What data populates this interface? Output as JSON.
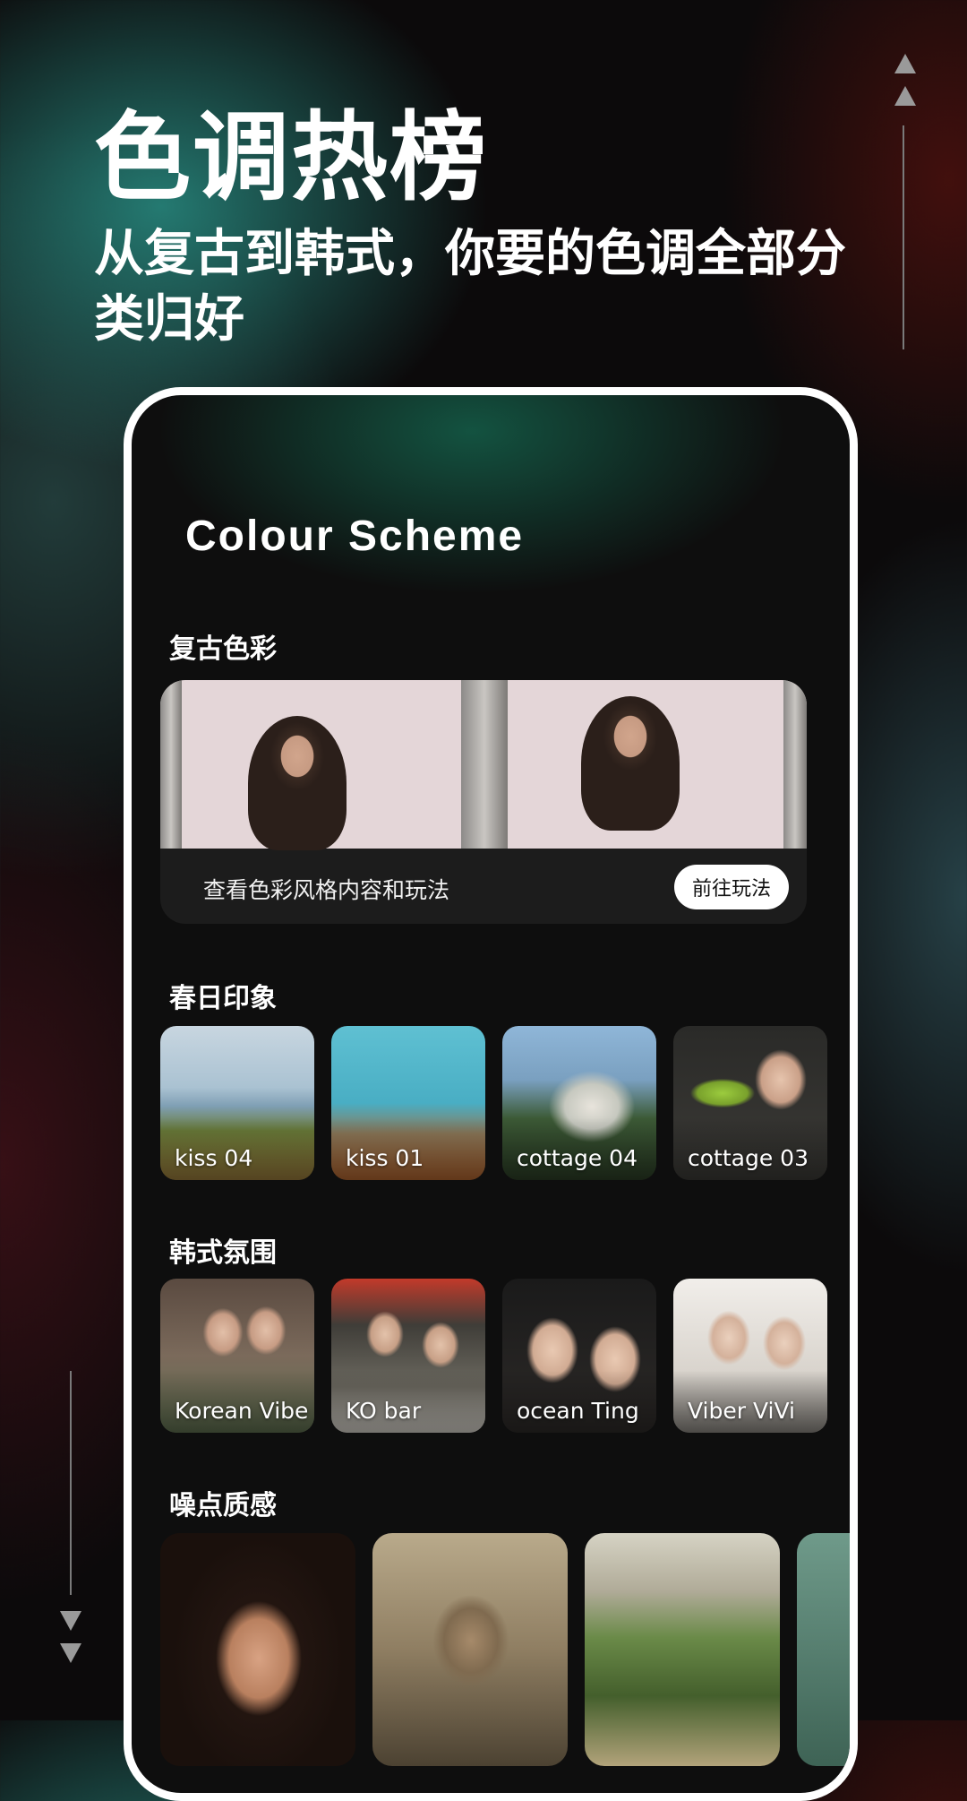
{
  "hero": {
    "title": "色调热榜",
    "subtitle": "从复古到韩式，你要的色调全部分类归好"
  },
  "screen": {
    "title": "Colour Scheme",
    "sections": {
      "retro": {
        "title": "复古色彩",
        "banner_text": "查看色彩风格内容和玩法",
        "button_label": "前往玩法"
      },
      "spring": {
        "title": "春日印象",
        "cards": [
          {
            "label": "kiss 04"
          },
          {
            "label": "kiss 01"
          },
          {
            "label": "cottage 04"
          },
          {
            "label": "cottage 03"
          }
        ]
      },
      "korean": {
        "title": "韩式氛围",
        "cards": [
          {
            "label": "Korean Vibe"
          },
          {
            "label": "KO bar"
          },
          {
            "label": "ocean Ting"
          },
          {
            "label": "Viber ViVi"
          }
        ]
      },
      "grain": {
        "title": "噪点质感"
      }
    }
  },
  "icons": {
    "scroll_up": "double-up-arrow-icon",
    "scroll_down": "double-down-arrow-icon"
  }
}
